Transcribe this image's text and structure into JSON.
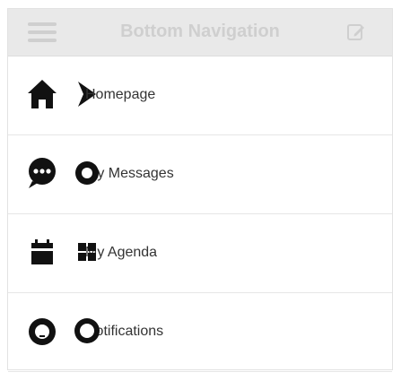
{
  "header": {
    "title": "Bottom Navigation"
  },
  "nav": {
    "items": [
      {
        "label": "Homepage",
        "icon": "home-icon"
      },
      {
        "label": "My Messages",
        "icon": "chat-bubble-icon"
      },
      {
        "label": "My Agenda",
        "icon": "calendar-icon"
      },
      {
        "label": "Notifications",
        "icon": "bell-icon"
      }
    ]
  },
  "side_icons": [
    {
      "icon": "chevron-right-icon"
    }
  ],
  "colors": {
    "header_bg": "#e9e9e9",
    "header_text": "#cfcfcf",
    "icon": "#111111",
    "label": "#333333",
    "divider": "#e6e6e6"
  }
}
